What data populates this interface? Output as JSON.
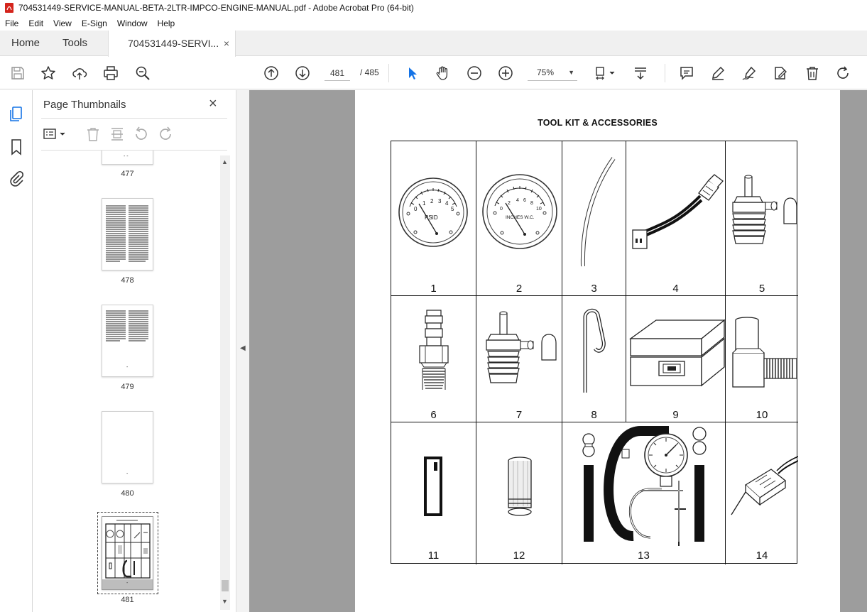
{
  "window": {
    "title": "704531449-SERVICE-MANUAL-BETA-2LTR-IMPCO-ENGINE-MANUAL.pdf - Adobe Acrobat Pro (64-bit)"
  },
  "menu": [
    "File",
    "Edit",
    "View",
    "E-Sign",
    "Window",
    "Help"
  ],
  "tabs": {
    "home": "Home",
    "tools": "Tools",
    "document": "704531449-SERVI...",
    "close": "×"
  },
  "toolbar": {
    "current_page": "481",
    "total_pages": "/ 485",
    "zoom": "75%",
    "icons": [
      "save-icon",
      "star-icon",
      "upload-icon",
      "print-icon",
      "zoom-search-icon",
      "page-up-icon",
      "page-down-icon",
      "select-cursor-icon",
      "hand-icon",
      "zoom-out-icon",
      "zoom-in-icon",
      "page-fit-icon",
      "scroll-mode-icon",
      "comment-icon",
      "highlight-pen-icon",
      "sign-icon",
      "edit-pdf-icon",
      "delete-icon",
      "rotate-icon"
    ]
  },
  "thumbnails_panel": {
    "title": "Page Thumbnails",
    "close": "×",
    "pages": [
      {
        "label": "477",
        "marker": "- -"
      },
      {
        "label": "478",
        "marker": ""
      },
      {
        "label": "479",
        "marker": "-"
      },
      {
        "label": "480",
        "marker": "-"
      },
      {
        "label": "481",
        "marker": "-"
      }
    ]
  },
  "document": {
    "heading": "TOOL KIT & ACCESSORIES",
    "items": [
      "1",
      "2",
      "3",
      "4",
      "5",
      "6",
      "7",
      "8",
      "9",
      "10",
      "11",
      "12",
      "13",
      "14"
    ],
    "gauge_labels": {
      "psid": "PSID",
      "inches_wc": "INCHES W.C.",
      "psid_scale": [
        "0",
        "1",
        "2",
        "3",
        "4",
        "5"
      ],
      "inches_scale": [
        "0",
        "2",
        "4",
        "6",
        "8",
        "10"
      ]
    }
  },
  "colors": {
    "acrobat_red": "#d4241c",
    "doc_background": "#9d9d9d",
    "tab_bar": "#f0f0f0"
  }
}
